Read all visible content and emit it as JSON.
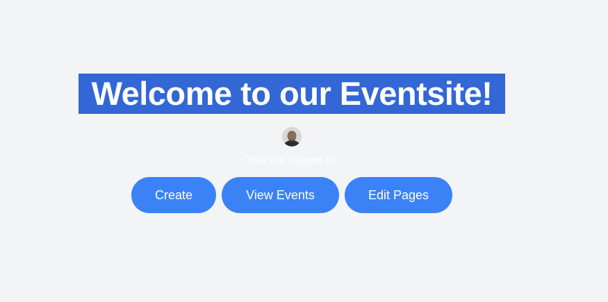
{
  "hero": {
    "title": "Welcome to our Eventsite!"
  },
  "user": {
    "avatar_icon": "user-avatar",
    "status_text": "Your are Logged In!"
  },
  "actions": {
    "create_label": "Create",
    "view_events_label": "View Events",
    "edit_pages_label": "Edit Pages"
  },
  "colors": {
    "page_background": "#f3f4f6",
    "title_highlight": "#3367d6",
    "button_background": "#3b82f6",
    "button_text": "#ffffff"
  }
}
